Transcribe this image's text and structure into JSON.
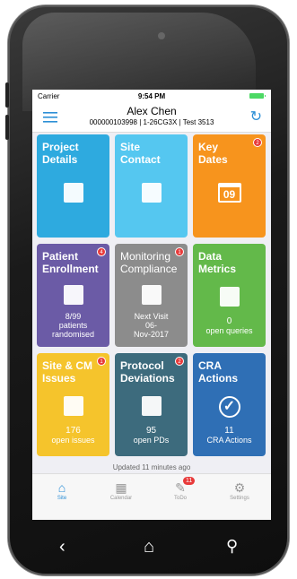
{
  "status": {
    "carrier": "Carrier",
    "time": "9:54 PM"
  },
  "header": {
    "name": "Alex Chen",
    "subtitle": "000000103998 | 1-26CG3X | Test 3513"
  },
  "tiles": [
    {
      "title1": "Project",
      "title2": "Details",
      "color": "#2eaadf",
      "icon": "folder-icon"
    },
    {
      "title1": "Site",
      "title2": "Contact",
      "color": "#55c7f0",
      "icon": "contact-card-icon"
    },
    {
      "title1": "Key",
      "title2": "Dates",
      "color": "#f7941d",
      "icon": "calendar-icon",
      "icon_text": "09",
      "badge": "2"
    },
    {
      "title1": "Patient",
      "title2": "Enrollment",
      "color": "#6b5ba6",
      "icon": "people-icon",
      "badge": "4",
      "stat1": "8/99",
      "stat2": "patients",
      "stat3": "randomised"
    },
    {
      "title1": "Monitoring",
      "title2": "Compliance",
      "color": "#8c8c8c",
      "icon": "document-calendar-icon",
      "badge": "1",
      "stat1": "Next Visit",
      "stat2": "06-",
      "stat3": "Nov-2017"
    },
    {
      "title1": "Data",
      "title2": "Metrics",
      "color": "#63b94a",
      "icon": "sd-card-icon",
      "stat1": "0",
      "stat2": "open queries"
    },
    {
      "title1": "Site & CM",
      "title2": "Issues",
      "color": "#f5c42c",
      "icon": "issues-icon",
      "badge": "1",
      "stat1": "176",
      "stat2": "open issues"
    },
    {
      "title1": "Protocol",
      "title2": "Deviations",
      "color": "#3d6b7d",
      "icon": "chart-document-icon",
      "badge": "2",
      "stat1": "95",
      "stat2": "open PDs"
    },
    {
      "title1": "CRA",
      "title2": "Actions",
      "color": "#2f6fb5",
      "icon": "check-icon",
      "stat1": "11",
      "stat2": "CRA Actions"
    }
  ],
  "updated": "Updated 11 minutes ago",
  "tabs": [
    {
      "label": "Site",
      "icon": "home-icon"
    },
    {
      "label": "Calendar",
      "icon": "calendar-grid-icon"
    },
    {
      "label": "ToDo",
      "icon": "edit-icon",
      "badge": "11"
    },
    {
      "label": "Settings",
      "icon": "gear-icon"
    }
  ]
}
